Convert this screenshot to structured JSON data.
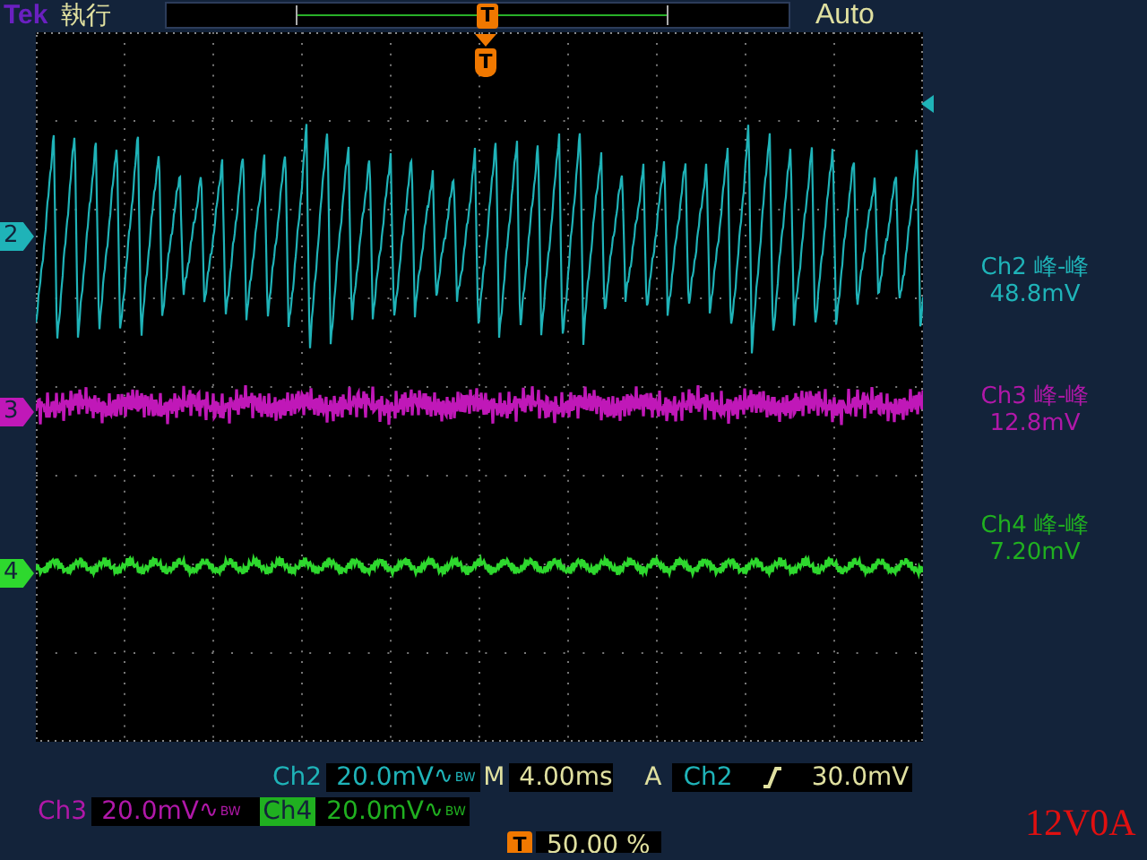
{
  "header": {
    "brand": "Tek",
    "run_state": "執行",
    "position_marker": "T",
    "trigger_mode": "Auto"
  },
  "screen": {
    "trigger_marker": "T",
    "channel_markers": [
      {
        "label": "2",
        "color": "#1fb3b8",
        "kind": "sawtooth"
      },
      {
        "label": "3",
        "color": "#c018b8",
        "kind": "noise"
      },
      {
        "label": "4",
        "color": "#2ed82e",
        "kind": "ripple"
      }
    ]
  },
  "measurements": [
    {
      "name": "Ch2 峰-峰",
      "value": "48.8mV",
      "color": "#1fb3b8"
    },
    {
      "name": "Ch3 峰-峰",
      "value": "12.8mV",
      "color": "#b018a8"
    },
    {
      "name": "Ch4 峰-峰",
      "value": "7.20mV",
      "color": "#20b020"
    }
  ],
  "vertical": [
    {
      "channel": "Ch2",
      "scale": "20.0mV",
      "coupling": "∿",
      "bandwidth": "BW",
      "color": "#1fb3b8",
      "highlighted": false
    },
    {
      "channel": "Ch3",
      "scale": "20.0mV",
      "coupling": "∿",
      "bandwidth": "BW",
      "color": "#b018a8",
      "highlighted": false
    },
    {
      "channel": "Ch4",
      "scale": "20.0mV",
      "coupling": "∿",
      "bandwidth": "BW",
      "color": "#20b020",
      "highlighted": true
    }
  ],
  "horizontal": {
    "prefix": "M",
    "scale": "4.00ms"
  },
  "trigger": {
    "prefix": "A",
    "source": "Ch2",
    "level": "30.0mV"
  },
  "trigger_position": {
    "marker": "T",
    "value": "50.00 %"
  },
  "annotation": "12V0A"
}
